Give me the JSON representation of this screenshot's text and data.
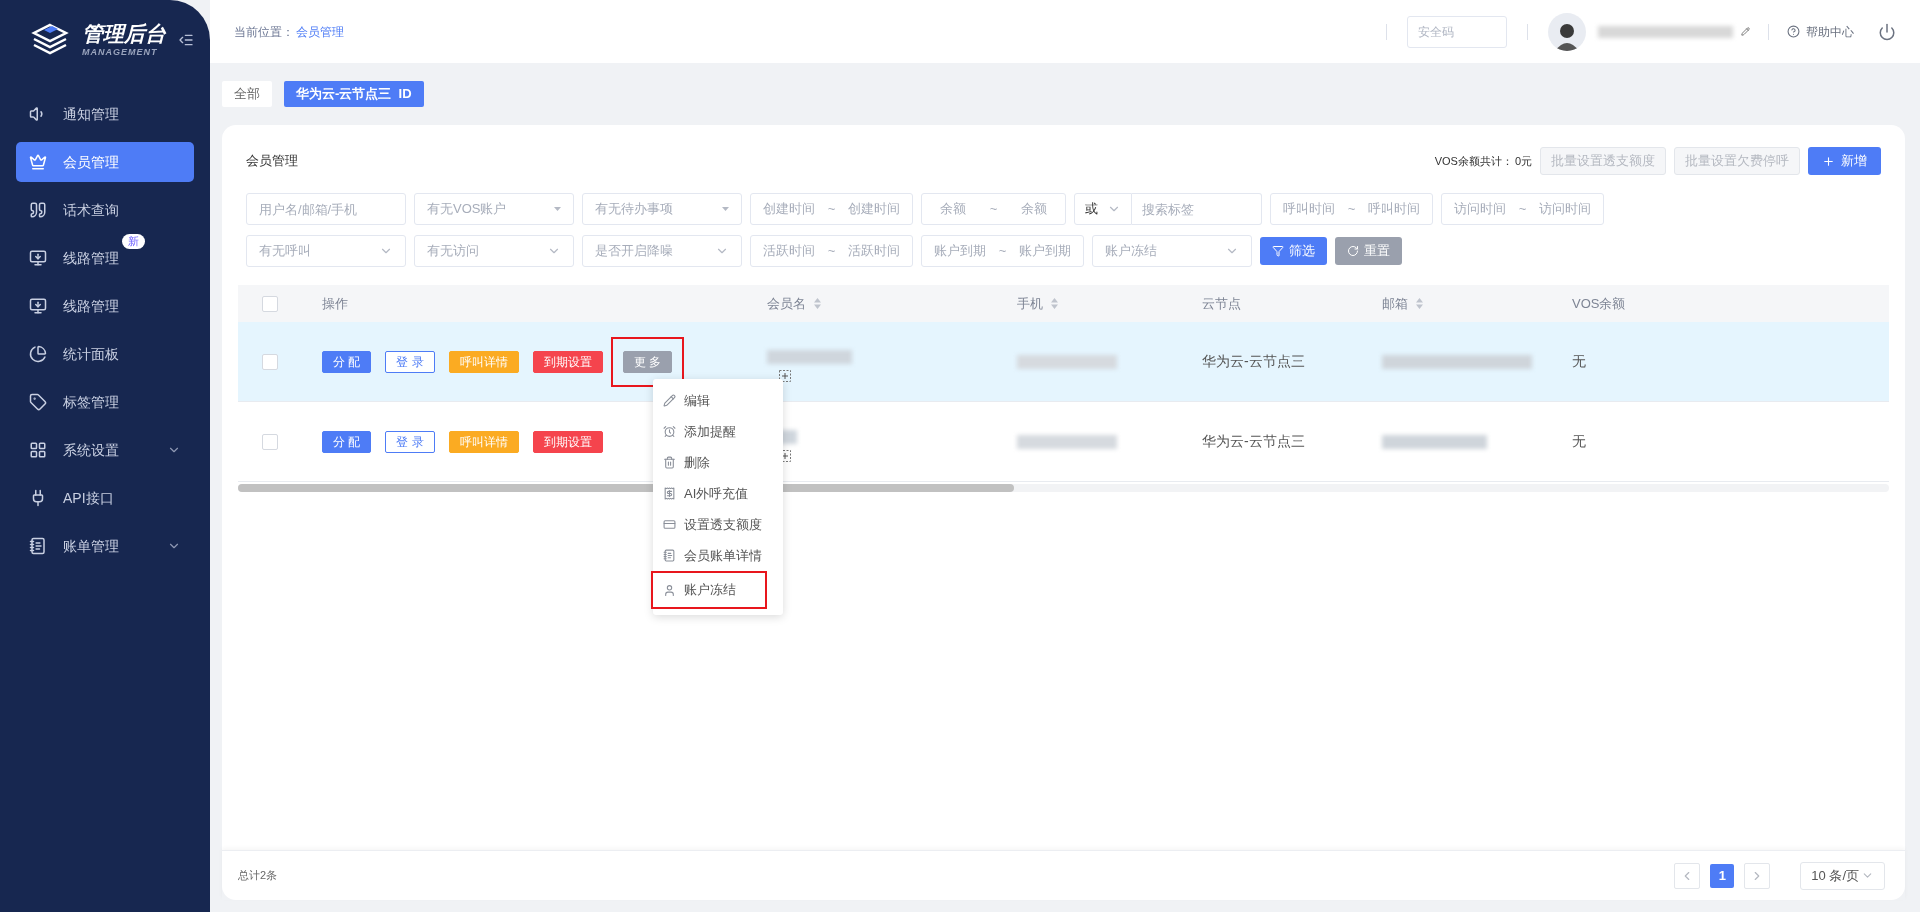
{
  "sidebar": {
    "logo_title": "管理后台",
    "logo_subtitle": "MANAGEMENT",
    "items": [
      {
        "label": "通知管理",
        "selected": false,
        "expandable": false
      },
      {
        "label": "会员管理",
        "selected": true,
        "expandable": false
      },
      {
        "label": "话术查询",
        "selected": false,
        "expandable": false
      },
      {
        "label": "线路管理",
        "selected": false,
        "expandable": false,
        "badge": "新"
      },
      {
        "label": "线路管理",
        "selected": false,
        "expandable": false
      },
      {
        "label": "统计面板",
        "selected": false,
        "expandable": false
      },
      {
        "label": "标签管理",
        "selected": false,
        "expandable": false
      },
      {
        "label": "系统设置",
        "selected": false,
        "expandable": true
      },
      {
        "label": "API接口",
        "selected": false,
        "expandable": false
      },
      {
        "label": "账单管理",
        "selected": false,
        "expandable": true
      }
    ]
  },
  "header": {
    "breadcrumb_label": "当前位置：",
    "breadcrumb_current": "会员管理",
    "security_placeholder": "安全码",
    "help": "帮助中心"
  },
  "tags": [
    {
      "label": "全部",
      "selected": false
    },
    {
      "label": "华为云-云节点三  ID",
      "selected": true
    }
  ],
  "panel": {
    "title": "会员管理",
    "vos_total_label": "VOS余额共计：",
    "vos_total": "0元",
    "buttons": [
      {
        "label": "批量设置透支额度",
        "kind": "batch",
        "disabled": true
      },
      {
        "label": "批量设置欠费停呼",
        "kind": "batch",
        "disabled": true
      },
      {
        "label": "新增",
        "kind": "add",
        "disabled": false
      }
    ]
  },
  "filter_rows": [
    [
      {
        "kind": "text",
        "placeholder": "用户名/邮箱/手机"
      },
      {
        "kind": "select",
        "placeholder": "有无VOS账户"
      },
      {
        "kind": "select",
        "placeholder": "有无待办事项"
      },
      {
        "kind": "range",
        "from": "创建时间",
        "separator": "~",
        "to": "创建时间"
      },
      {
        "kind": "amount",
        "from": "余额",
        "separator": "~",
        "to": "余额"
      },
      {
        "kind": "tag-search",
        "mode": "或",
        "placeholder": "搜索标签"
      },
      {
        "kind": "range",
        "from": "呼叫时间",
        "separator": "~",
        "to": "呼叫时间"
      },
      {
        "kind": "range",
        "from": "访问时间",
        "separator": "~",
        "to": "访问时间"
      }
    ],
    [
      {
        "kind": "dropdown",
        "placeholder": "有无呼叫"
      },
      {
        "kind": "dropdown",
        "placeholder": "有无访问"
      },
      {
        "kind": "dropdown",
        "placeholder": "是否开启降噪"
      },
      {
        "kind": "range",
        "from": "活跃时间",
        "separator": "~",
        "to": "活跃时间"
      },
      {
        "kind": "range",
        "from": "账户到期",
        "separator": "~",
        "to": "账户到期"
      },
      {
        "kind": "dropdown",
        "placeholder": "账户冻结"
      },
      {
        "kind": "filter",
        "label": "筛选"
      },
      {
        "kind": "reset",
        "label": "重置"
      }
    ]
  ],
  "table": {
    "all_checked": false,
    "columns": [
      {
        "label": "操作",
        "sortable": false
      },
      {
        "label": "会员名",
        "sortable": true
      },
      {
        "label": "手机",
        "sortable": true
      },
      {
        "label": "云节点",
        "sortable": false
      },
      {
        "label": "邮箱",
        "sortable": true
      },
      {
        "label": "VOS余额",
        "sortable": false
      }
    ],
    "rows": [
      {
        "checked": false,
        "selected": true,
        "actions": [
          {
            "label": "分 配",
            "kind": "primary"
          },
          {
            "label": "登 录",
            "kind": "outline"
          },
          {
            "label": "呼叫详情",
            "kind": "warning"
          },
          {
            "label": "到期设置",
            "kind": "danger"
          },
          {
            "label": "更 多",
            "kind": "more",
            "highlighted": true
          }
        ],
        "node": "华为云-云节点三",
        "vos": "无"
      },
      {
        "checked": false,
        "selected": false,
        "actions": [
          {
            "label": "分 配",
            "kind": "primary"
          },
          {
            "label": "登 录",
            "kind": "outline"
          },
          {
            "label": "呼叫详情",
            "kind": "warning"
          },
          {
            "label": "到期设置",
            "kind": "danger"
          }
        ],
        "node": "华为云-云节点三",
        "vos": "无"
      }
    ]
  },
  "more_menu": [
    {
      "label": "编辑",
      "highlighted": false
    },
    {
      "label": "添加提醒",
      "highlighted": false
    },
    {
      "label": "删除",
      "highlighted": false
    },
    {
      "label": "AI外呼充值",
      "highlighted": false
    },
    {
      "label": "设置透支额度",
      "highlighted": false
    },
    {
      "label": "会员账单详情",
      "highlighted": false
    },
    {
      "label": "账户冻结",
      "highlighted": true
    }
  ],
  "footer": {
    "total": "总计2条",
    "pages": [
      {
        "label": "1",
        "selected": true
      }
    ],
    "page_size": "10 条/页"
  }
}
